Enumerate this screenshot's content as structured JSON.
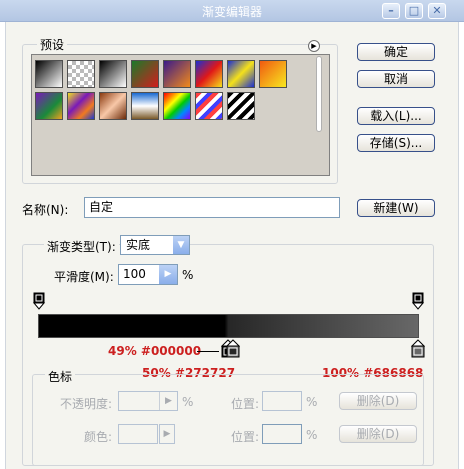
{
  "window": {
    "title": "渐变编辑器",
    "min_label": "–",
    "max_label": "□",
    "close_label": "✕"
  },
  "presets": {
    "title": "预设",
    "menu_icon": "play-triangle-icon",
    "swatches": [
      {
        "name": "black-white",
        "css": "linear-gradient(135deg,#000 0%,#fff 100%)"
      },
      {
        "name": "transparent-checker",
        "css": "repeating-conic-gradient(#bbb 0 25%, #fff 0 50%) 0 0/8px 8px"
      },
      {
        "name": "black-white-2",
        "css": "linear-gradient(135deg,#000 0%,#fff 100%)"
      },
      {
        "name": "red-green",
        "css": "linear-gradient(135deg,#1a7a2a 0%,#d31d1d 100%)"
      },
      {
        "name": "violet-orange",
        "css": "linear-gradient(135deg,#3a1a8a 0%,#f28a1a 100%)"
      },
      {
        "name": "blue-red-yellow",
        "css": "linear-gradient(135deg,#1c2fd0 0%,#e01818 50%,#f5e11a 100%)"
      },
      {
        "name": "blue-yellow-blue",
        "css": "linear-gradient(135deg,#1c2fd0 0%,#f5e11a 50%,#1c2fd0 100%)"
      },
      {
        "name": "orange-yellow",
        "css": "linear-gradient(135deg,#f05a10 0%,#f8e820 100%)"
      },
      {
        "name": "violet-green-orange",
        "css": "linear-gradient(135deg,#7a1ab8 0%,#1a8a3a 60%,#f0a020 100%)"
      },
      {
        "name": "yellow-violet-orange-blue",
        "css": "linear-gradient(135deg,#f0e020 0%,#7a1ab8 40%,#f07a20 70%,#1a3ad0 100%)"
      },
      {
        "name": "copper",
        "css": "linear-gradient(135deg,#8a3a10 0%,#f8c8a8 50%,#6a2a08 100%)"
      },
      {
        "name": "chrome",
        "css": "linear-gradient(180deg,#1a6ad0 0%,#ffffff 50%,#7a5a2a 100%)"
      },
      {
        "name": "spectrum",
        "css": "linear-gradient(135deg,#f00 0%,#f80 20%,#ff0 35%,#0c0 55%,#08f 75%,#80f 100%)"
      },
      {
        "name": "transparent-rainbow",
        "css": "repeating-linear-gradient(135deg,#ff4040 0 4px,#ffffff 4px 8px,#4040ff 8px 12px)"
      },
      {
        "name": "transparent-stripes",
        "css": "repeating-linear-gradient(135deg,#000 0 4px,#fff 4px 8px)"
      }
    ]
  },
  "buttons": {
    "ok": "确定",
    "cancel": "取消",
    "load": "载入(L)...",
    "save": "存储(S)...",
    "new": "新建(W)"
  },
  "name_field": {
    "label": "名称(N):",
    "value": "自定"
  },
  "gradient_type": {
    "title": "渐变类型(T):",
    "value": "实底"
  },
  "smoothness": {
    "label": "平滑度(M):",
    "value": "100",
    "unit": "%"
  },
  "gradient_bar": {
    "left_color": "#000000",
    "mid_color": "#272727",
    "right_color": "#686868"
  },
  "stops_annotations": [
    {
      "text": "49% #000000"
    },
    {
      "text": "50% #272727"
    },
    {
      "text": "100% #686868"
    }
  ],
  "color_stops": {
    "title": "色标",
    "opacity_label": "不透明度:",
    "opacity_unit": "%",
    "position_label_1": "位置:",
    "position_unit_1": "%",
    "delete_label_1": "删除(D)",
    "color_label": "颜色:",
    "position_label_2": "位置:",
    "position_unit_2": "%",
    "delete_label_2": "删除(D)"
  }
}
